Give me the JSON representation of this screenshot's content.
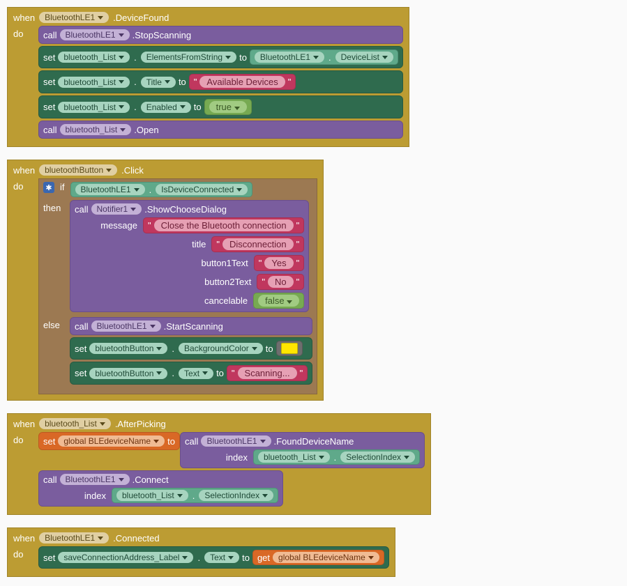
{
  "block1": {
    "when": "when",
    "component": "BluetoothLE1",
    "event": ".DeviceFound",
    "do": "do",
    "row1": {
      "call": "call",
      "comp": "BluetoothLE1",
      "method": ".StopScanning"
    },
    "row2": {
      "set": "set",
      "comp": "bluetooth_List",
      "prop": "ElementsFromString",
      "to": "to",
      "valComp": "BluetoothLE1",
      "valProp": "DeviceList"
    },
    "row3": {
      "set": "set",
      "comp": "bluetooth_List",
      "prop": "Title",
      "to": "to",
      "string": "Available Devices"
    },
    "row4": {
      "set": "set",
      "comp": "bluetooth_List",
      "prop": "Enabled",
      "to": "to",
      "bool": "true"
    },
    "row5": {
      "call": "call",
      "comp": "bluetooth_List",
      "method": ".Open"
    }
  },
  "block2": {
    "when": "when",
    "component": "bluetoothButton",
    "event": ".Click",
    "do": "do",
    "iff": "if",
    "ifCondComp": "BluetoothLE1",
    "ifCondProp": "IsDeviceConnected",
    "then": "then",
    "call": "call",
    "notifier": "Notifier1",
    "method": ".ShowChooseDialog",
    "argMessage": "message",
    "argMessageVal": "Close the Bluetooth connection",
    "argTitle": "title",
    "argTitleVal": "Disconnection",
    "argB1": "button1Text",
    "argB1Val": "Yes",
    "argB2": "button2Text",
    "argB2Val": "No",
    "argCancel": "cancelable",
    "argCancelVal": "false",
    "elsee": "else",
    "elseCall": "call",
    "elseComp": "BluetoothLE1",
    "elseMethod": ".StartScanning",
    "set1": "set",
    "set1Comp": "bluetoothButton",
    "set1Prop": "BackgroundColor",
    "set1To": "to",
    "set2": "set",
    "set2Comp": "bluetoothButton",
    "set2Prop": "Text",
    "set2To": "to",
    "set2Val": "Scanning..."
  },
  "block3": {
    "when": "when",
    "component": "bluetooth_List",
    "event": ".AfterPicking",
    "do": "do",
    "set": "set",
    "var": "global BLEdeviceName",
    "to": "to",
    "call": "call",
    "callComp": "BluetoothLE1",
    "callMethod": ".FoundDeviceName",
    "argIndex": "index",
    "idxComp": "bluetooth_List",
    "idxProp": "SelectionIndex",
    "call2": "call",
    "call2Comp": "BluetoothLE1",
    "call2Method": ".Connect",
    "arg2Index": "index",
    "idx2Comp": "bluetooth_List",
    "idx2Prop": "SelectionIndex"
  },
  "block4": {
    "when": "when",
    "component": "BluetoothLE1",
    "event": ".Connected",
    "do": "do",
    "set": "set",
    "comp": "saveConnectionAddress_Label",
    "prop": "Text",
    "to": "to",
    "get": "get",
    "var": "global BLEdeviceName"
  }
}
